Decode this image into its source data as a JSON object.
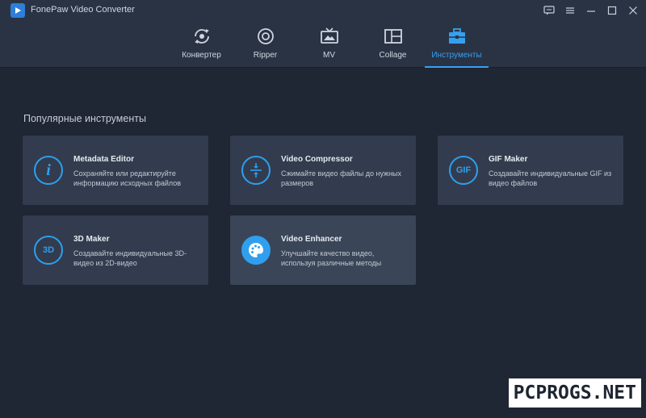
{
  "window": {
    "title": "FonePaw Video Converter"
  },
  "nav": {
    "tabs": [
      {
        "label": "Конвертер",
        "icon": "convert-icon"
      },
      {
        "label": "Ripper",
        "icon": "disc-icon"
      },
      {
        "label": "MV",
        "icon": "tv-icon"
      },
      {
        "label": "Collage",
        "icon": "collage-icon"
      },
      {
        "label": "Инструменты",
        "icon": "toolbox-icon",
        "active": true
      }
    ]
  },
  "section": {
    "title": "Популярные инструменты"
  },
  "tools": [
    {
      "title": "Metadata Editor",
      "desc": "Сохраняйте или редактируйте информацию исходных файлов",
      "icon": "info-icon"
    },
    {
      "title": "Video Compressor",
      "desc": "Сжимайте видео файлы до нужных размеров",
      "icon": "compress-icon"
    },
    {
      "title": "GIF Maker",
      "desc": "Создавайте индивидуальные GIF из видео файлов",
      "icon": "gif-icon",
      "icon_text": "GIF"
    },
    {
      "title": "3D Maker",
      "desc": "Создавайте индивидуальные 3D-видео из 2D-видео",
      "icon": "3d-icon",
      "icon_text": "3D"
    },
    {
      "title": "Video Enhancer",
      "desc": "Улучшайте качество видео, используя различные методы",
      "icon": "palette-icon"
    }
  ],
  "watermark": {
    "text": "PCPROGS.NET"
  },
  "colors": {
    "background": "#1f2634",
    "topbar": "#2a3344",
    "card": "#323c4e",
    "accent": "#36a0f0"
  }
}
